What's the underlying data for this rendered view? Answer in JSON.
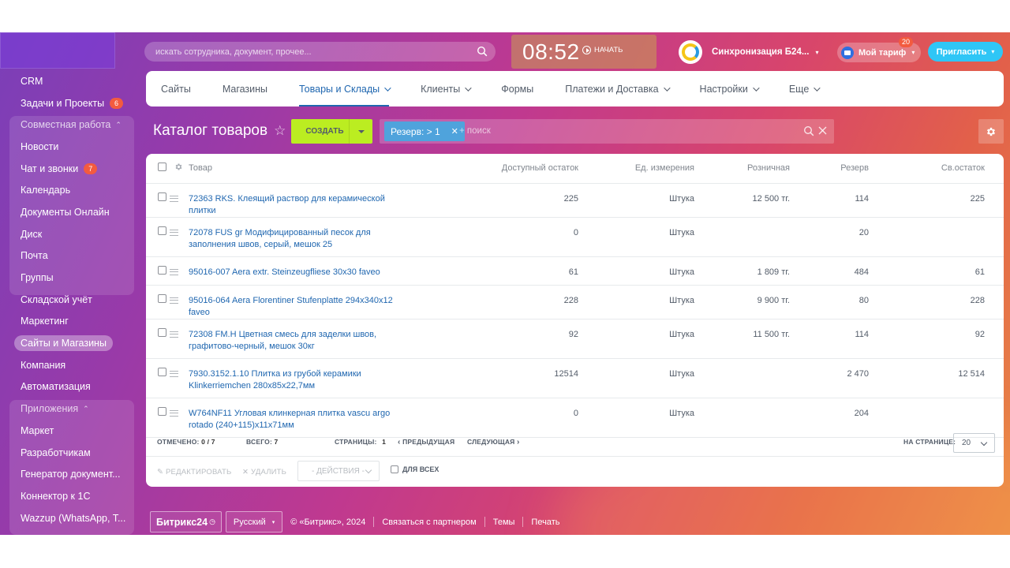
{
  "sidebar": {
    "items": [
      {
        "label": "CRM"
      },
      {
        "label": "Задачи и Проекты",
        "badge": "6"
      },
      {
        "label": "Совместная работа",
        "group": true
      },
      {
        "label": "Новости"
      },
      {
        "label": "Чат и звонки",
        "badge": "7"
      },
      {
        "label": "Календарь"
      },
      {
        "label": "Документы Онлайн"
      },
      {
        "label": "Диск"
      },
      {
        "label": "Почта"
      },
      {
        "label": "Группы"
      },
      {
        "label": "Складской учёт"
      },
      {
        "label": "Маркетинг"
      },
      {
        "label": "Сайты и Магазины",
        "active": true
      },
      {
        "label": "Компания"
      },
      {
        "label": "Автоматизация"
      },
      {
        "label": "Приложения",
        "group": true
      },
      {
        "label": "Маркет"
      },
      {
        "label": "Разработчикам"
      },
      {
        "label": "Генератор документ..."
      },
      {
        "label": "Коннектор к 1С"
      },
      {
        "label": "Wazzup (WhatsApp, T..."
      }
    ]
  },
  "topbar": {
    "search_placeholder": "искать сотрудника, документ, прочее...",
    "time": "08:52",
    "start_label": "НАЧАТЬ",
    "sync_label": "Синхронизация Б24...",
    "tariff_label": "Мой тариф",
    "tariff_count": "20",
    "invite_label": "Пригласить"
  },
  "tabs": [
    {
      "label": "Сайты",
      "dropdown": false
    },
    {
      "label": "Магазины",
      "dropdown": false
    },
    {
      "label": "Товары и Склады",
      "dropdown": true,
      "active": true
    },
    {
      "label": "Клиенты",
      "dropdown": true
    },
    {
      "label": "Формы",
      "dropdown": false
    },
    {
      "label": "Платежи и Доставка",
      "dropdown": true
    },
    {
      "label": "Настройки",
      "dropdown": true
    },
    {
      "label": "Еще",
      "dropdown": true
    }
  ],
  "page": {
    "title": "Каталог товаров",
    "create_label": "СОЗДАТЬ",
    "filter_chip": "Резерв: > 1",
    "filter_placeholder": "+ поиск"
  },
  "grid": {
    "columns": {
      "name": "Товар",
      "available": "Доступный остаток",
      "unit": "Ед. измерения",
      "retail": "Розничная",
      "reserve": "Резерв",
      "free": "Св.остаток"
    },
    "rows": [
      {
        "name": "72363 RKS. Клеящий раствор для керамической плитки",
        "available": "225",
        "unit": "Штука",
        "retail": "12 500 тг.",
        "reserve": "114",
        "free": "225"
      },
      {
        "name": "72078 FUS gr Модифицированный песок для заполнения швов, серый, мешок 25",
        "available": "0",
        "unit": "Штука",
        "retail": "",
        "reserve": "20",
        "free": ""
      },
      {
        "name": "95016-007 Aera extr. Steinzeugfliese 30x30 faveo",
        "available": "61",
        "unit": "Штука",
        "retail": "1 809 тг.",
        "reserve": "484",
        "free": "61"
      },
      {
        "name": "95016-064 Aera Florentiner Stufenplatte 294x340x12 faveo",
        "available": "228",
        "unit": "Штука",
        "retail": "9 900 тг.",
        "reserve": "80",
        "free": "228"
      },
      {
        "name": "72308 FM.H Цветная смесь для заделки швов, графитово-черный, мешок 30кг",
        "available": "92",
        "unit": "Штука",
        "retail": "11 500 тг.",
        "reserve": "114",
        "free": "92"
      },
      {
        "name": "7930.3152.1.10 Плитка из грубой керамики Klinkerriemchen 280x85x22,7мм",
        "available": "12514",
        "unit": "Штука",
        "retail": "",
        "reserve": "2 470",
        "free": "12 514"
      },
      {
        "name": "W764NF11 Угловая клинкерная плитка vascu argo rotado (240+115)x11x71мм",
        "available": "0",
        "unit": "Штука",
        "retail": "",
        "reserve": "204",
        "free": ""
      }
    ],
    "pager": {
      "selected_label": "ОТМЕЧЕНО:",
      "selected_value": "0 / 7",
      "total_label": "ВСЕГО:",
      "total_value": "7",
      "pages_label": "СТРАНИЦЫ:",
      "pages_value": "1",
      "prev_label": "ПРЕДЫДУЩАЯ",
      "next_label": "СЛЕДУЮЩАЯ",
      "per_page_label": "НА СТРАНИЦЕ:",
      "per_page_value": "20"
    },
    "actions": {
      "edit_label": "РЕДАКТИРОВАТЬ",
      "delete_label": "УДАЛИТЬ",
      "actions_select": "- ДЕЙСТВИЯ -",
      "for_all_label": "ДЛЯ ВСЕХ"
    }
  },
  "footer": {
    "brand": "Битрикс24",
    "language": "Русский",
    "copyright": "© «Битрикс», 2024",
    "partner_link": "Связаться с партнером",
    "themes_link": "Темы",
    "print_link": "Печать"
  },
  "colors": {
    "accent_blue": "#2067b0",
    "create_green": "#bbed21",
    "invite_cyan": "#2fc6f6",
    "badge_red": "#f35b3f",
    "chip_blue": "#4fa3dc"
  }
}
